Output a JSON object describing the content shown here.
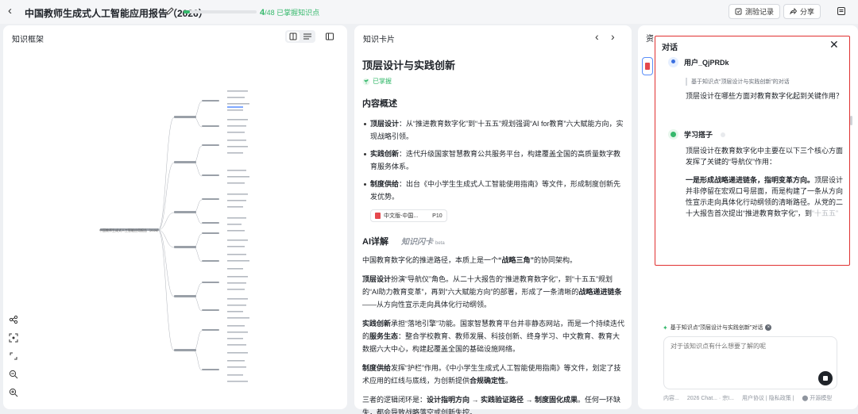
{
  "topbar": {
    "title": "中国教师生成式人工智能应用报告（2026）",
    "progress_current": "4",
    "progress_total": "/48",
    "progress_label": "已掌握知识点",
    "progress_fraction": 0.083,
    "test_record_label": "测验记录",
    "share_label": "分享"
  },
  "left_panel": {
    "title": "知识框架",
    "root_node": "中国教师生成式人工智能应用报告（2026）"
  },
  "mid_panel": {
    "title": "知识卡片",
    "card_title": "顶层设计与实践创新",
    "mastered_label": "已掌握",
    "overview_heading": "内容概述",
    "bullets": [
      {
        "term": "顶层设计",
        "text": "：从“推进教育数字化”到“十五五”规划强调“AI for教育”六大赋能方向，实现战略引领。"
      },
      {
        "term": "实践创新",
        "text": "：迭代升级国家智慧教育公共服务平台，构建覆盖全国的高质量数字教育服务体系。"
      },
      {
        "term": "制度供给",
        "text": "：出台《中小学生生成式人工智能使用指南》等文件，形成制度创新先发优势。"
      }
    ],
    "source_chip": "中文版-中国...",
    "source_page": "P10",
    "tab_ai": "AI详解",
    "tab_flash": "知识闪卡",
    "tab_flash_badge": "beta",
    "ai_intro": "中国教育数字化的推进路径，本质上是一个",
    "ai_intro_bold": "“战略三角”",
    "ai_intro_end": "的协同架构。",
    "p1_bold1": "顶层设计",
    "p1_a": "扮演“导航仪”角色。从二十大报告的“推进教育数字化”，到“十五五”规划的“AI助力教育变革”，再到“六大赋能方向”的部署，形成了一条清晰的",
    "p1_bold2": "战略递进链条",
    "p1_b": "——从方向性宣示走向具体化行动纲领。",
    "p2_bold1": "实践创新",
    "p2_a": "承担“落地引擎”功能。国家智慧教育平台并非静态网站，而是一个持续迭代的",
    "p2_bold2": "服务生态",
    "p2_b": "：整合学校教育、教师发展、科技创新、终身学习、中文教育、教育大数据六大中心，构建起覆盖全国的基础设施网络。",
    "p3_bold1": "制度供给",
    "p3_a": "发挥“护栏”作用。《中小学生生成式人工智能使用指南》等文件，划定了技术应用的红线与底线，为创新提供",
    "p3_bold2": "合规确定性",
    "p3_b": "。",
    "p4_a": "三者的逻辑闭环是：",
    "p4_bold": "设计指明方向 → 实践验证路径 → 制度固化成果",
    "p4_b": "。任何一环缺失，都会导致战略落空或创新失控。"
  },
  "right_panel": {
    "tab_hint": "资",
    "context_line": "基于知识点“顶层设计与实践创新”对话",
    "input_placeholder": "对于该知识点有什么想要了解的呢",
    "footer_a": "内容...",
    "footer_b": "2026 Chat... · 宗I...",
    "footer_c": "用户协议 | 隐私政策 |",
    "footer_d": "开源模型"
  },
  "chat": {
    "title": "对话",
    "user_name": "用户_QjPRDk",
    "quote": "基于知识点“顶层设计与实践创新”的对话",
    "user_msg": "顶层设计在哪些方面对教育数字化起到关键作用？",
    "bot_name": "学习搭子",
    "bot_p1": "顶层设计在教育数字化中主要在以下三个核心方面发挥了关键的“导航仪”作用：",
    "bot_p2_bold": "一是形成战略递进链条，指明变革方向。",
    "bot_p2": "顶层设计并非停留在宏观口号层面，而是构建了一条从方向性宣示走向具体化行动纲领的清晰路径。从党的二十大报告首次提出“推进教育数字化”，到",
    "bot_p2_fade": "“十五五”"
  },
  "colors": {
    "accent_green": "#35b86b",
    "highlight_red": "#e03131",
    "primary_blue": "#3b6fe0"
  }
}
